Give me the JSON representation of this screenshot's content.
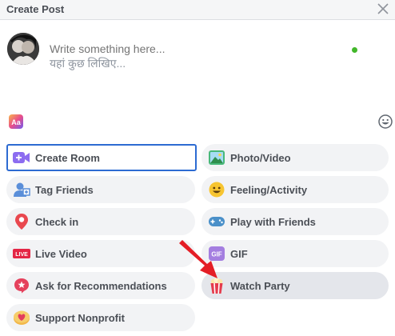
{
  "header": {
    "title": "Create Post"
  },
  "composer": {
    "placeholder": "Write something here...",
    "hint": "यहां कुछ लिखिए..."
  },
  "actions": [
    {
      "label": "Create Room",
      "icon": "video-camera-plus-icon"
    },
    {
      "label": "Photo/Video",
      "icon": "photo-icon"
    },
    {
      "label": "Tag Friends",
      "icon": "tag-friends-icon"
    },
    {
      "label": "Feeling/Activity",
      "icon": "smiley-icon"
    },
    {
      "label": "Check in",
      "icon": "location-pin-icon"
    },
    {
      "label": "Play with Friends",
      "icon": "gamepad-icon"
    },
    {
      "label": "Live Video",
      "icon": "live-icon",
      "icon_text": "LIVE"
    },
    {
      "label": "GIF",
      "icon": "gif-icon",
      "icon_text": "GIF"
    },
    {
      "label": "Ask for Recommendations",
      "icon": "recommendations-icon"
    },
    {
      "label": "Watch Party",
      "icon": "popcorn-icon"
    },
    {
      "label": "Support Nonprofit",
      "icon": "heart-coin-icon"
    }
  ],
  "toolbar": {
    "text_style_label": "Aa"
  },
  "colors": {
    "accent": "#2d6bd2",
    "button_bg": "#f2f3f5",
    "online": "#42b72a",
    "arrow": "#e41e26"
  }
}
